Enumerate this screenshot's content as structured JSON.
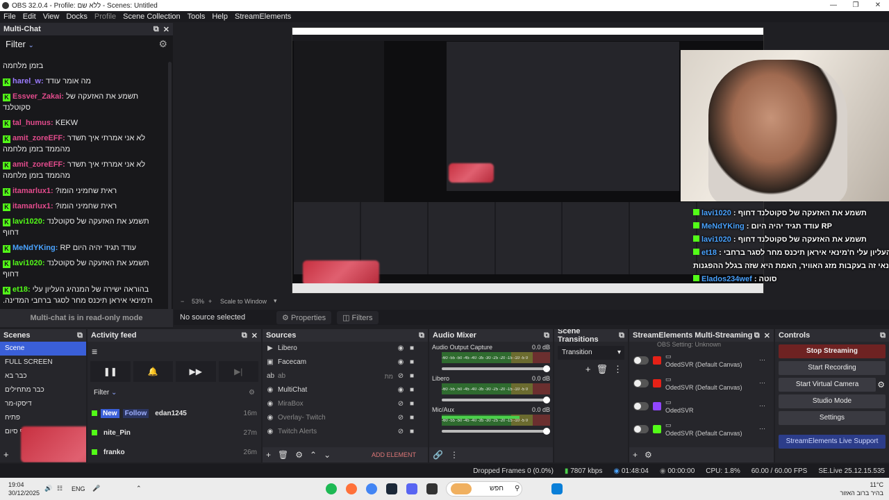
{
  "window": {
    "title": "OBS 32.0.4 - Profile: ללא שם - Scenes: Untitled"
  },
  "menu": [
    "File",
    "Edit",
    "View",
    "Docks",
    "Profile",
    "Scene Collection",
    "Tools",
    "Help",
    "StreamElements"
  ],
  "multichat": {
    "title": "Multi-Chat",
    "filter_label": "Filter",
    "footer": "Multi-chat is in read-only mode",
    "messages": [
      {
        "user": "",
        "color": "#e8e8e8",
        "text": "בזמן מלחמה"
      },
      {
        "user": "harel_w:",
        "color": "#9b7bff",
        "text": "מה אומר עודד"
      },
      {
        "user": "Essver_Zakai:",
        "color": "#e24b8c",
        "text": "תשמע את האזעקה של סקוטלנד"
      },
      {
        "user": "tal_humus:",
        "color": "#e24b8c",
        "text": "KEKW"
      },
      {
        "user": "amit_zoreEFF:",
        "color": "#e24b8c",
        "text": "לא אני אמרתי איך תשדר מהממד בזמן מלחמה"
      },
      {
        "user": "amit_zoreEFF:",
        "color": "#e24b8c",
        "text": "לא אני אמרתי איך תשדר מהממד בזמן מלחמה"
      },
      {
        "user": "itamarlux1:",
        "color": "#e24b8c",
        "text": "ראית שחמיני הומו?"
      },
      {
        "user": "itamarlux1:",
        "color": "#e24b8c",
        "text": "ראית שחמיני הומו?"
      },
      {
        "user": "lavi1020:",
        "color": "#53fc18",
        "text": "תשמע את האזעקה של סקוטלנד דחוף"
      },
      {
        "user": "MeNdYKing:",
        "color": "#4aa3ff",
        "text": "עודד תגיד יהיה היום RP"
      },
      {
        "user": "lavi1020:",
        "color": "#53fc18",
        "text": "תשמע את האזעקה של סקוטלנד דחוף"
      },
      {
        "user": "et18:",
        "color": "#53fc18",
        "text": "בהוראה ישירה של המנהיג העליון עלי ח'מינאי איראן תיכנס מחר לסגר ברחבי המדינה. לטענת ח'מינאי זה בעקבות מזג האוויר, האמת היא שזה בגלל ההפגנות."
      },
      {
        "user": "Elados234wef:",
        "color": "#53fc18",
        "text": "סוטה"
      }
    ]
  },
  "preview": {
    "zoom_text": "53%",
    "scale_mode": "Scale to Window",
    "overlay_chat": [
      {
        "user": "lavi1020",
        "text": "תשמע את האזעקה של סקוטלנד דחוף"
      },
      {
        "user": "MeNdYKing",
        "text": "עודד תגיד יהיה היום RP"
      },
      {
        "user": "lavi1020",
        "text": "תשמע את האזעקה של סקוטלנד דחוף"
      },
      {
        "user": "et18",
        "text": "בהוראה ישירה של המנהיג העליון עלי ח'מינאי איראן תיכנס מחר לסגר ברחבי"
      },
      {
        "user": "",
        "text": "ח'מינאי זה בעקבות מזג האוויר, האמת היא שזה בגלל ההפגנות"
      },
      {
        "user": "Elados234wef",
        "text": "סוטה"
      }
    ]
  },
  "source_bar": {
    "no_source": "No source selected",
    "properties": "Properties",
    "filters": "Filters"
  },
  "scenes": {
    "title": "Scenes",
    "items": [
      "Scene",
      "FULL SCREEN",
      "כבר בא",
      "כבר מתחילים",
      "דיסקו-מר",
      "פתיח",
      "סוף סיום"
    ]
  },
  "activity": {
    "title": "Activity feed",
    "filter": "Filter",
    "items": [
      {
        "badge_new": "New",
        "badge_type": "Follow",
        "user": "edan1245",
        "time": "16m"
      },
      {
        "badge_new": "",
        "badge_type": "",
        "user": "nite_Pin",
        "time": "27m"
      },
      {
        "badge_new": "",
        "badge_type": "",
        "user": "franko",
        "time": "26m"
      }
    ]
  },
  "sources": {
    "title": "Sources",
    "items": [
      {
        "name": "Libero",
        "icon": "play-icon",
        "visible": true
      },
      {
        "name": "Facecam",
        "icon": "camera-icon",
        "visible": true
      },
      {
        "name": "ab",
        "icon": "text-icon",
        "visible": false,
        "extra": "מת"
      },
      {
        "name": "MultiChat",
        "icon": "browser-icon",
        "visible": true
      },
      {
        "name": "MiraBox",
        "icon": "browser-icon",
        "visible": false
      },
      {
        "name": "Overlay- Twitch",
        "icon": "browser-icon",
        "visible": false
      },
      {
        "name": "Twitch Alerts",
        "icon": "browser-icon",
        "visible": false
      }
    ],
    "add_element": "ADD ELEMENT"
  },
  "mixer": {
    "title": "Audio Mixer",
    "ticks": "-60 -55 -50 -45 -40 -35 -30 -25 -20 -15 -10 -5 0",
    "channels": [
      {
        "name": "Audio Output Capture",
        "db": "0.0 dB",
        "level": 0.0
      },
      {
        "name": "Libero",
        "db": "0.0 dB",
        "level": 0.0
      },
      {
        "name": "Mic/Aux",
        "db": "0.0 dB",
        "level": 0.72
      }
    ]
  },
  "transitions": {
    "title": "Scene Transitions",
    "selected": "Transition"
  },
  "multistream": {
    "title": "StreamElements Multi-Streaming",
    "top_note": "OBS Setting: Unknown",
    "rows": [
      {
        "platform": "youtube",
        "color": "#e62117",
        "label": "OdedSVR (Default Canvas)"
      },
      {
        "platform": "youtube",
        "color": "#e62117",
        "label": "OdedSVR (Default Canvas)"
      },
      {
        "platform": "twitch",
        "color": "#9146ff",
        "label": "OdedSVR"
      },
      {
        "platform": "kick",
        "color": "#53fc18",
        "label": "OdedSVR (Default Canvas)"
      }
    ]
  },
  "controls": {
    "title": "Controls",
    "stop_streaming": "Stop Streaming",
    "start_recording": "Start Recording",
    "start_virtual_camera": "Start Virtual Camera",
    "studio_mode": "Studio Mode",
    "settings": "Settings",
    "live_support": "StreamElements Live Support"
  },
  "statusbar": {
    "dropped": "Dropped Frames 0 (0.0%)",
    "kbps": "7807 kbps",
    "live_time": "01:48:04",
    "rec_time": "00:00:00",
    "cpu": "CPU: 1.8%",
    "fps": "60.00 / 60.00 FPS",
    "version": "SE.Live 25.12.15.535"
  },
  "taskbar": {
    "time": "19:04",
    "date": "30/12/2025",
    "lang": "ENG",
    "search": "חפש",
    "weather_temp": "11°C",
    "weather_text": "בהיר ברוב האזור"
  }
}
